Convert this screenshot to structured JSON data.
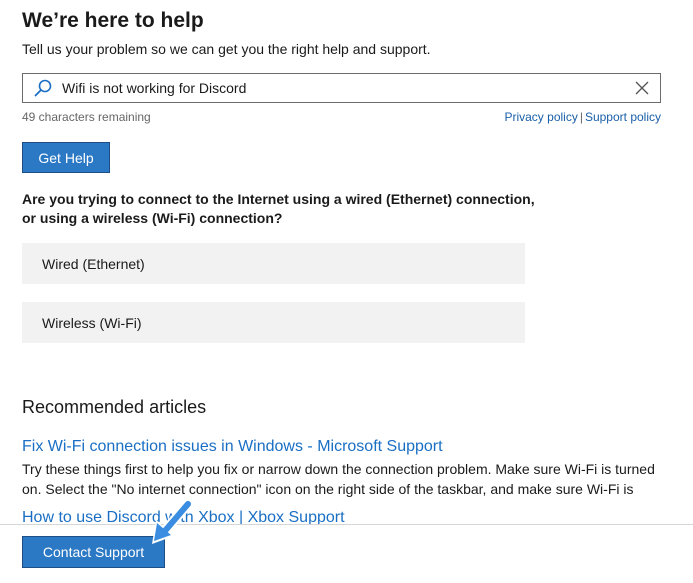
{
  "header": {
    "title": "We’re here to help",
    "subtitle": "Tell us your problem so we can get you the right help and support."
  },
  "search": {
    "value": "Wifi is not working for Discord",
    "chars_remaining": "49 characters remaining",
    "icon": "search-icon",
    "clear_icon": "close-icon"
  },
  "links": {
    "privacy": "Privacy policy",
    "separator": "|",
    "support": "Support policy"
  },
  "get_help": {
    "label": "Get Help"
  },
  "question": {
    "line1": "Are you trying to connect to the Internet using a wired (Ethernet) connection,",
    "line2": "or using a wireless (Wi-Fi) connection?"
  },
  "options": [
    {
      "label": "Wired (Ethernet)"
    },
    {
      "label": "Wireless (Wi-Fi)"
    }
  ],
  "recommended": {
    "title": "Recommended articles",
    "articles": [
      {
        "title": "Fix Wi-Fi connection issues in Windows - Microsoft Support",
        "desc": "Try these things first to help you fix or narrow down the connection problem. Make sure Wi-Fi is turned on. Select the \"No internet connection\" icon on the right side of the taskbar, and make sure Wi-Fi is"
      },
      {
        "title": "How to use Discord with Xbox | Xbox Support"
      }
    ]
  },
  "footer": {
    "contact_label": "Contact Support"
  },
  "colors": {
    "accent": "#2b78c5",
    "link": "#1a6fc4",
    "option_bg": "#f2f2f2",
    "pointer": "#3a8de0"
  }
}
